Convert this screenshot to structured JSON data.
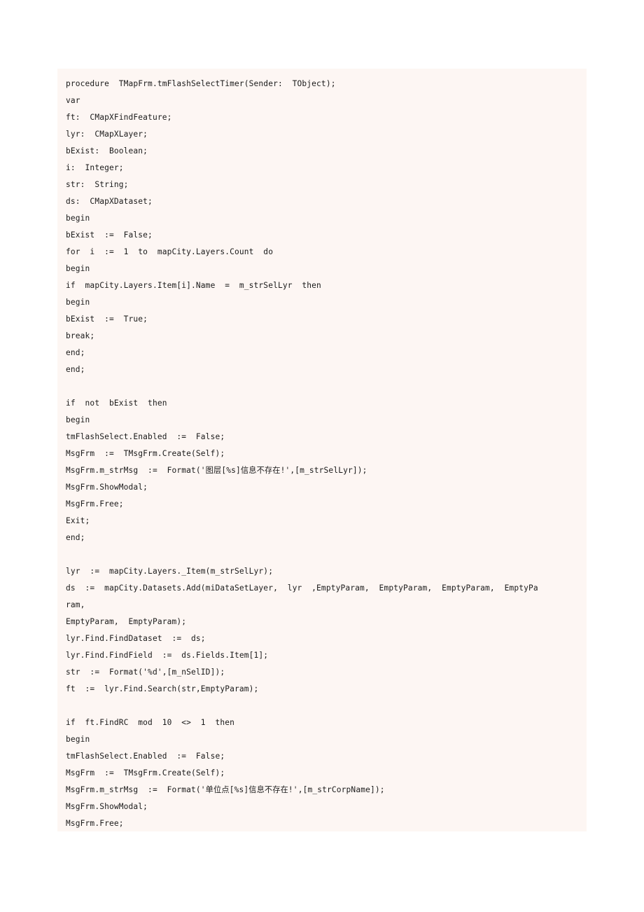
{
  "document": {
    "background_color": "#ffffff",
    "code_block_background": "#fdf6f3",
    "text_color": "#1a1a1a",
    "language": "Delphi/Object Pascal"
  },
  "code": {
    "lines": [
      "procedure  TMapFrm.tmFlashSelectTimer(Sender:  TObject);",
      "var",
      "ft:  CMapXFindFeature;",
      "lyr:  CMapXLayer;",
      "bExist:  Boolean;",
      "i:  Integer;",
      "str:  String;",
      "ds:  CMapXDataset;",
      "begin",
      "bExist  :=  False;",
      "for  i  :=  1  to  mapCity.Layers.Count  do",
      "begin",
      "if  mapCity.Layers.Item[i].Name  =  m_strSelLyr  then",
      "begin",
      "bExist  :=  True;",
      "break;",
      "end;",
      "end;",
      "",
      "if  not  bExist  then",
      "begin",
      "tmFlashSelect.Enabled  :=  False;",
      "MsgFrm  :=  TMsgFrm.Create(Self);",
      "MsgFrm.m_strMsg  :=  Format('图层[%s]信息不存在!',[m_strSelLyr]);",
      "MsgFrm.ShowModal;",
      "MsgFrm.Free;",
      "Exit;",
      "end;",
      "",
      "lyr  :=  mapCity.Layers._Item(m_strSelLyr);",
      "ds  :=  mapCity.Datasets.Add(miDataSetLayer,  lyr  ,EmptyParam,  EmptyParam,  EmptyParam,  EmptyPa",
      "ram,",
      "EmptyParam,  EmptyParam);",
      "lyr.Find.FindDataset  :=  ds;",
      "lyr.Find.FindField  :=  ds.Fields.Item[1];",
      "str  :=  Format('%d',[m_nSelID]);",
      "ft  :=  lyr.Find.Search(str,EmptyParam);",
      "",
      "if  ft.FindRC  mod  10  <>  1  then",
      "begin",
      "tmFlashSelect.Enabled  :=  False;",
      "MsgFrm  :=  TMsgFrm.Create(Self);",
      "MsgFrm.m_strMsg  :=  Format('单位点[%s]信息不存在!',[m_strCorpName]);",
      "MsgFrm.ShowModal;",
      "MsgFrm.Free;"
    ]
  }
}
